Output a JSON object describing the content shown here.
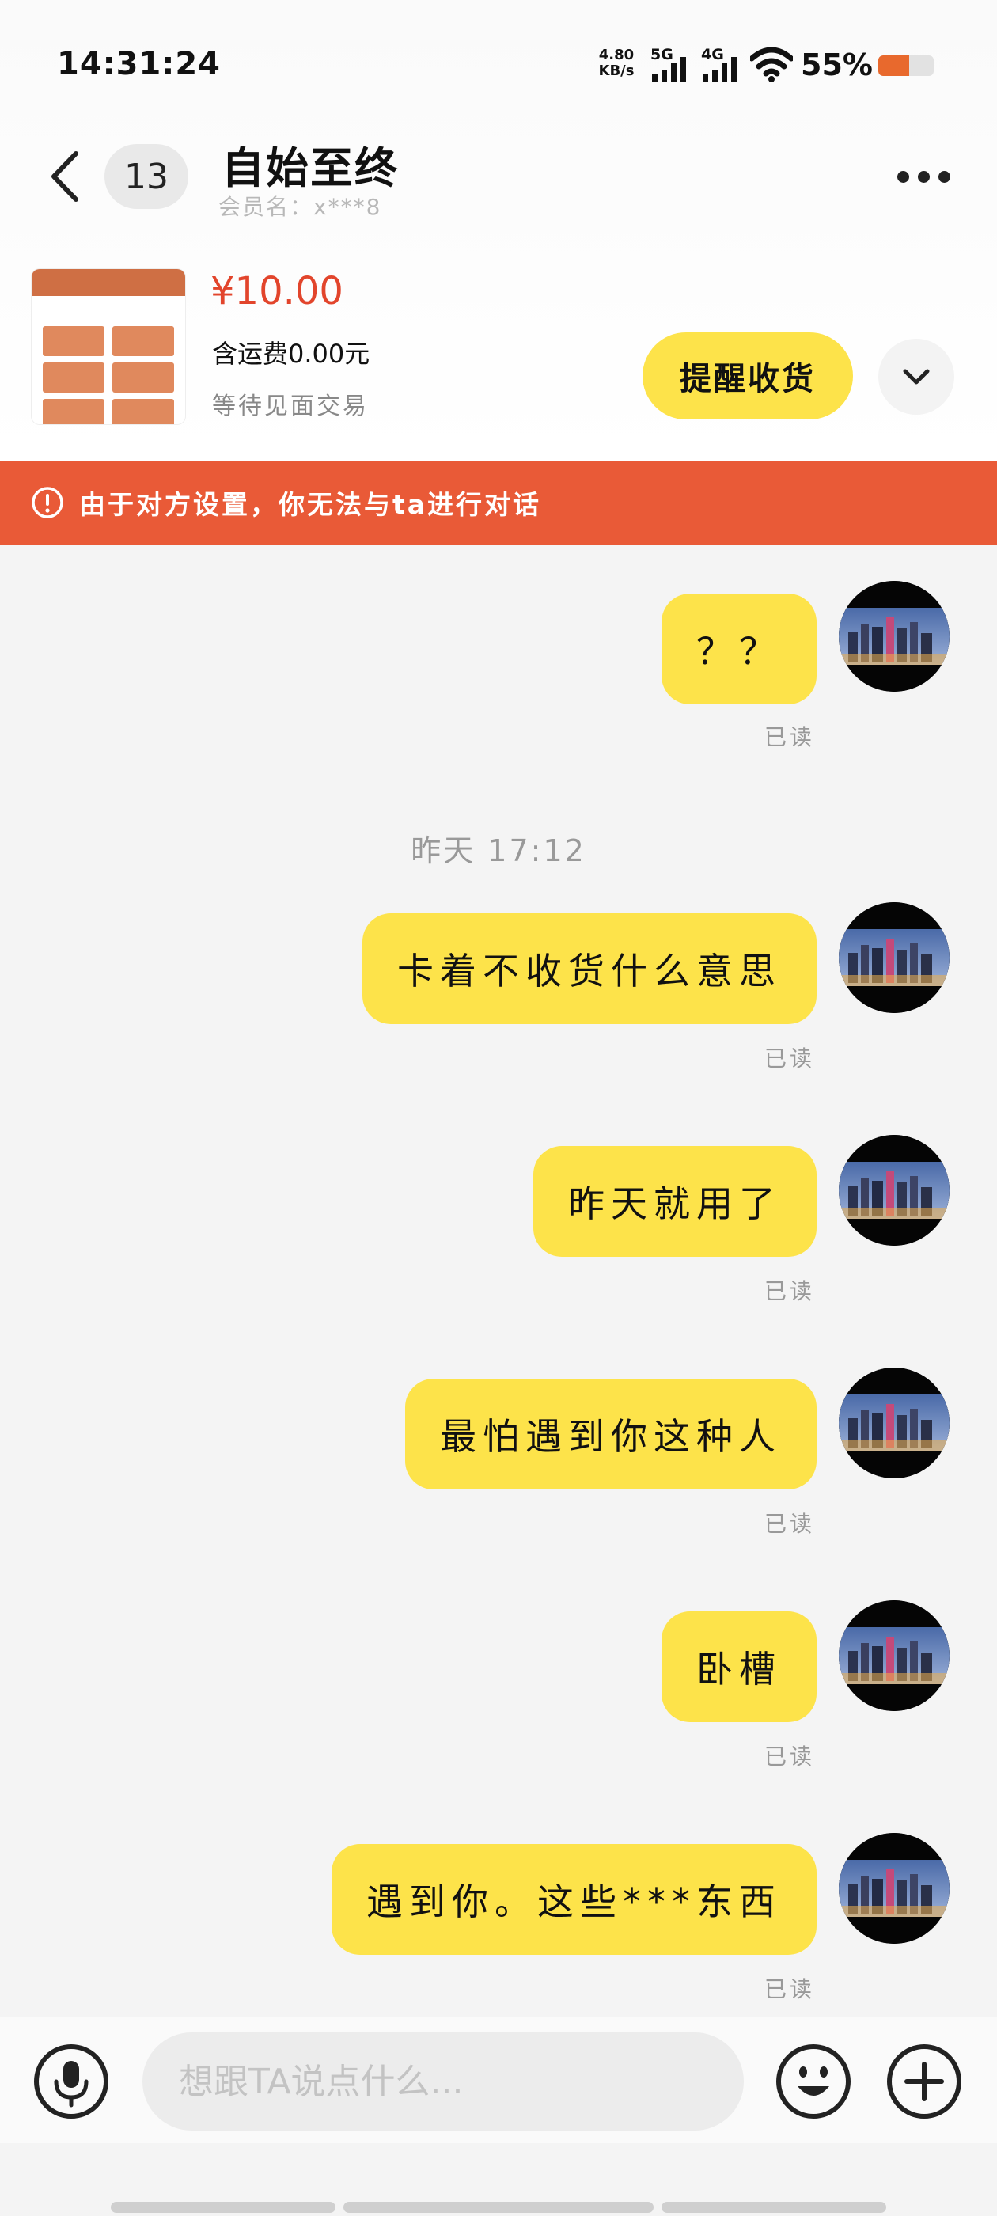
{
  "status_bar": {
    "time": "14:31:24",
    "net_speed_value": "4.80",
    "net_speed_unit": "KB/s",
    "signal_1_label": "5G",
    "signal_2_label": "4G",
    "battery_percent": "55%",
    "battery_level": 0.55,
    "battery_color": "#e8692d"
  },
  "header": {
    "unread_count": "13",
    "contact_name": "自始至终",
    "member_name": "会员名：x***8"
  },
  "product": {
    "price": "¥10.00",
    "shipping": "含运费0.00元",
    "status": "等待见面交易",
    "remind_button": "提醒收货"
  },
  "warning": {
    "text": "由于对方设置，你无法与ta进行对话",
    "color": "#e95a37"
  },
  "chat": {
    "bubble_color": "#fde34a",
    "messages": [
      {
        "text": "？？",
        "read": "已读"
      },
      {
        "text": "卡着不收货什么意思",
        "read": "已读"
      },
      {
        "text": "昨天就用了",
        "read": "已读"
      },
      {
        "text": "最怕遇到你这种人",
        "read": "已读"
      },
      {
        "text": "卧槽",
        "read": "已读"
      },
      {
        "text": "遇到你。这些***东西",
        "read": "已读"
      }
    ],
    "time_separator": "昨天 17:12"
  },
  "input": {
    "placeholder": "想跟TA说点什么..."
  },
  "icons": {
    "back": "chevron-left-icon",
    "more": "more-horizontal-icon",
    "expand": "chevron-down-icon",
    "warning": "exclamation-circle-icon",
    "voice": "microphone-icon",
    "emoji": "smiley-icon",
    "plus": "plus-circle-icon"
  }
}
